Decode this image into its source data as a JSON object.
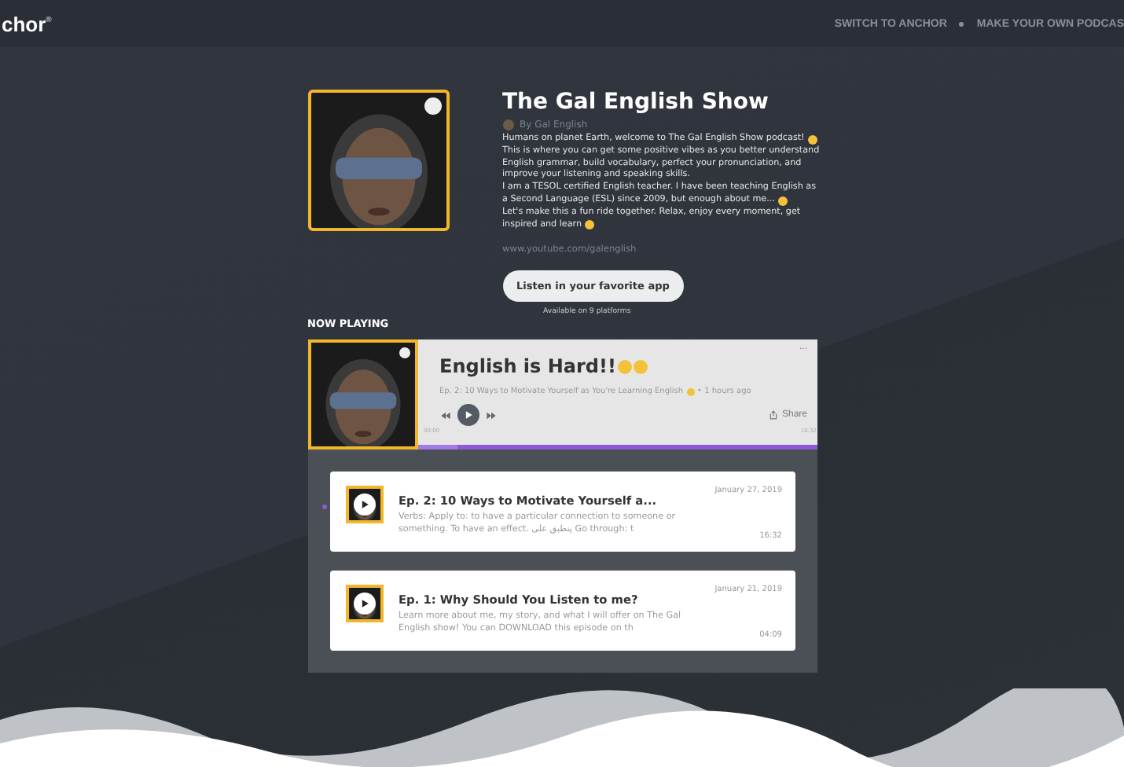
{
  "topbar": {
    "logo": "chor",
    "logo_mark": "®",
    "links": [
      {
        "label": "SWITCH TO ANCHOR"
      },
      {
        "label": "MAKE YOUR OWN PODCAS"
      }
    ]
  },
  "podcast": {
    "title": "The Gal English Show",
    "author": "By Gal English",
    "description_lines": [
      {
        "text": "Humans on planet Earth, welcome to The Gal English Show podcast!",
        "emoji": true
      },
      {
        "text": "This is where you can get some positive vibes as you better understand",
        "emoji": false
      },
      {
        "text": "English grammar, build vocabulary, perfect your pronunciation, and",
        "emoji": false
      },
      {
        "text": "improve your listening and speaking skills.",
        "emoji": false
      },
      {
        "text": "I am a TESOL certified English teacher. I have been teaching English as",
        "emoji": false
      },
      {
        "text": "a Second Language (ESL) since 2009, but enough about me...",
        "emoji": true
      },
      {
        "text": "Let's make this a fun ride together. Relax, enjoy every moment, get",
        "emoji": false
      },
      {
        "text": "inspired and learn",
        "emoji": true
      }
    ],
    "link": "www.youtube.com/galenglish",
    "listen_button": "Listen in your favorite app",
    "platforms": "Available on 9 platforms"
  },
  "now_playing": {
    "heading": "NOW PLAYING",
    "title": "English is Hard!!",
    "title_emojis": true,
    "subtitle": "Ep. 2: 10 Ways to Motivate Yourself as You're Learning English",
    "age": "• 1 hours ago",
    "menu": "...",
    "share": "Share",
    "elapsed": "00:00",
    "duration": "16:32",
    "level": 0.1
  },
  "episodes": [
    {
      "title": "Ep. 2: 10 Ways to Motivate Yourself a...",
      "date": "January 27, 2019",
      "summary": "Verbs:  Apply to: to have a particular connection to someone or something. To have an effect. ينطبق على Go through: t",
      "duration": "16:32",
      "selected": true
    },
    {
      "title": "Ep. 1: Why Should You Listen to me?",
      "date": "January 21, 2019",
      "summary": "Learn more about me, my story, and what I will offer on The Gal English show!  You can DOWNLOAD this episode on th",
      "duration": "04:09",
      "selected": false
    }
  ]
}
